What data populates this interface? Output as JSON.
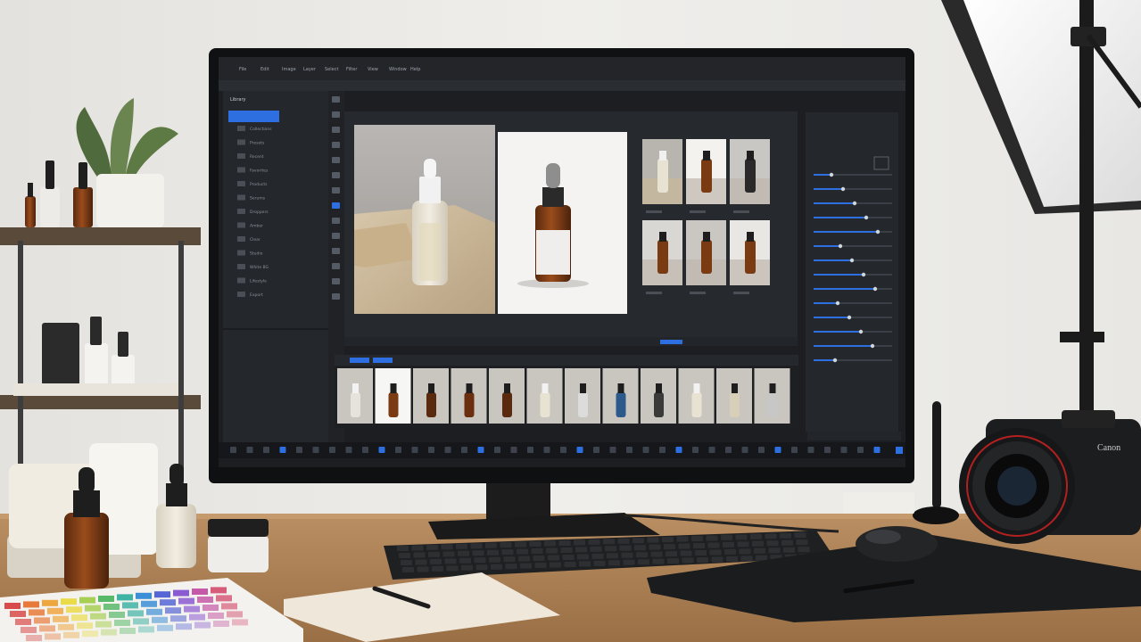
{
  "camera": {
    "badge": "Canon"
  },
  "editor": {
    "menu": [
      "File",
      "Edit",
      "Image",
      "Layer",
      "Select",
      "Filter",
      "View",
      "Window",
      "Help"
    ],
    "left_panel": {
      "title": "Library",
      "items": [
        "Collections",
        "Presets",
        "Recent",
        "Favorites",
        "Products",
        "Serums",
        "Droppers",
        "Amber",
        "Clear",
        "Studio",
        "White BG",
        "Lifestyle",
        "Export"
      ]
    },
    "filmstrip_count": 12
  }
}
